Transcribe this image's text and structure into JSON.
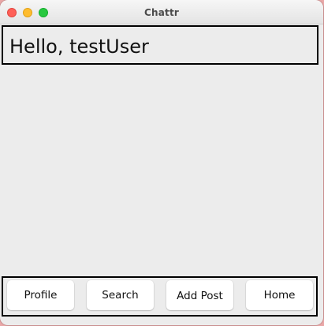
{
  "window": {
    "title": "Chattr"
  },
  "header": {
    "greeting": "Hello, testUser"
  },
  "nav": {
    "items": [
      {
        "label": "Profile"
      },
      {
        "label": "Search"
      },
      {
        "label": "Add Post"
      },
      {
        "label": "Home"
      }
    ]
  },
  "colors": {
    "window_bg": "#ececec",
    "close": "#fe5f57",
    "minimize": "#febc2e",
    "maximize": "#28c840"
  },
  "icons": [
    "close-icon",
    "minimize-icon",
    "maximize-icon"
  ]
}
